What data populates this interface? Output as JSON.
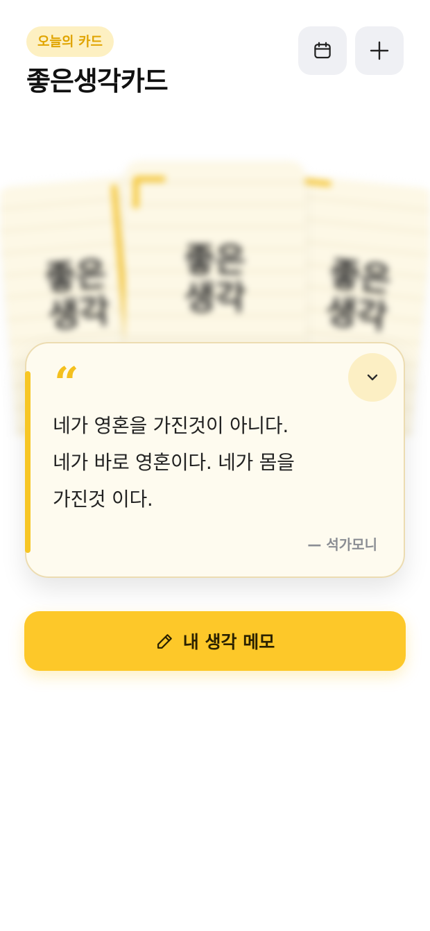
{
  "header": {
    "badge": "오늘의 카드",
    "title": "좋은생각카드",
    "calendar_icon": "calendar-icon",
    "add_icon": "plus-icon"
  },
  "card_stack": {
    "left_card_text": "좋은\n생각",
    "center_card_text": "좋은\n생각",
    "right_card_text": "좋은\n생각"
  },
  "quote": {
    "mark": "“",
    "text": "네가 영혼을 가진것이 아니다.\n네가 바로 영혼이다. 네가 몸을\n가진것 이다.",
    "author": "— 석가모니",
    "collapse_icon": "chevron-down-icon"
  },
  "memo_button": {
    "label": "내 생각 메모",
    "icon": "pencil-icon"
  },
  "colors": {
    "accent": "#fdc829",
    "badge_bg": "#fdf0c2",
    "badge_text": "#e0a400",
    "card_bg": "#fefbef"
  }
}
